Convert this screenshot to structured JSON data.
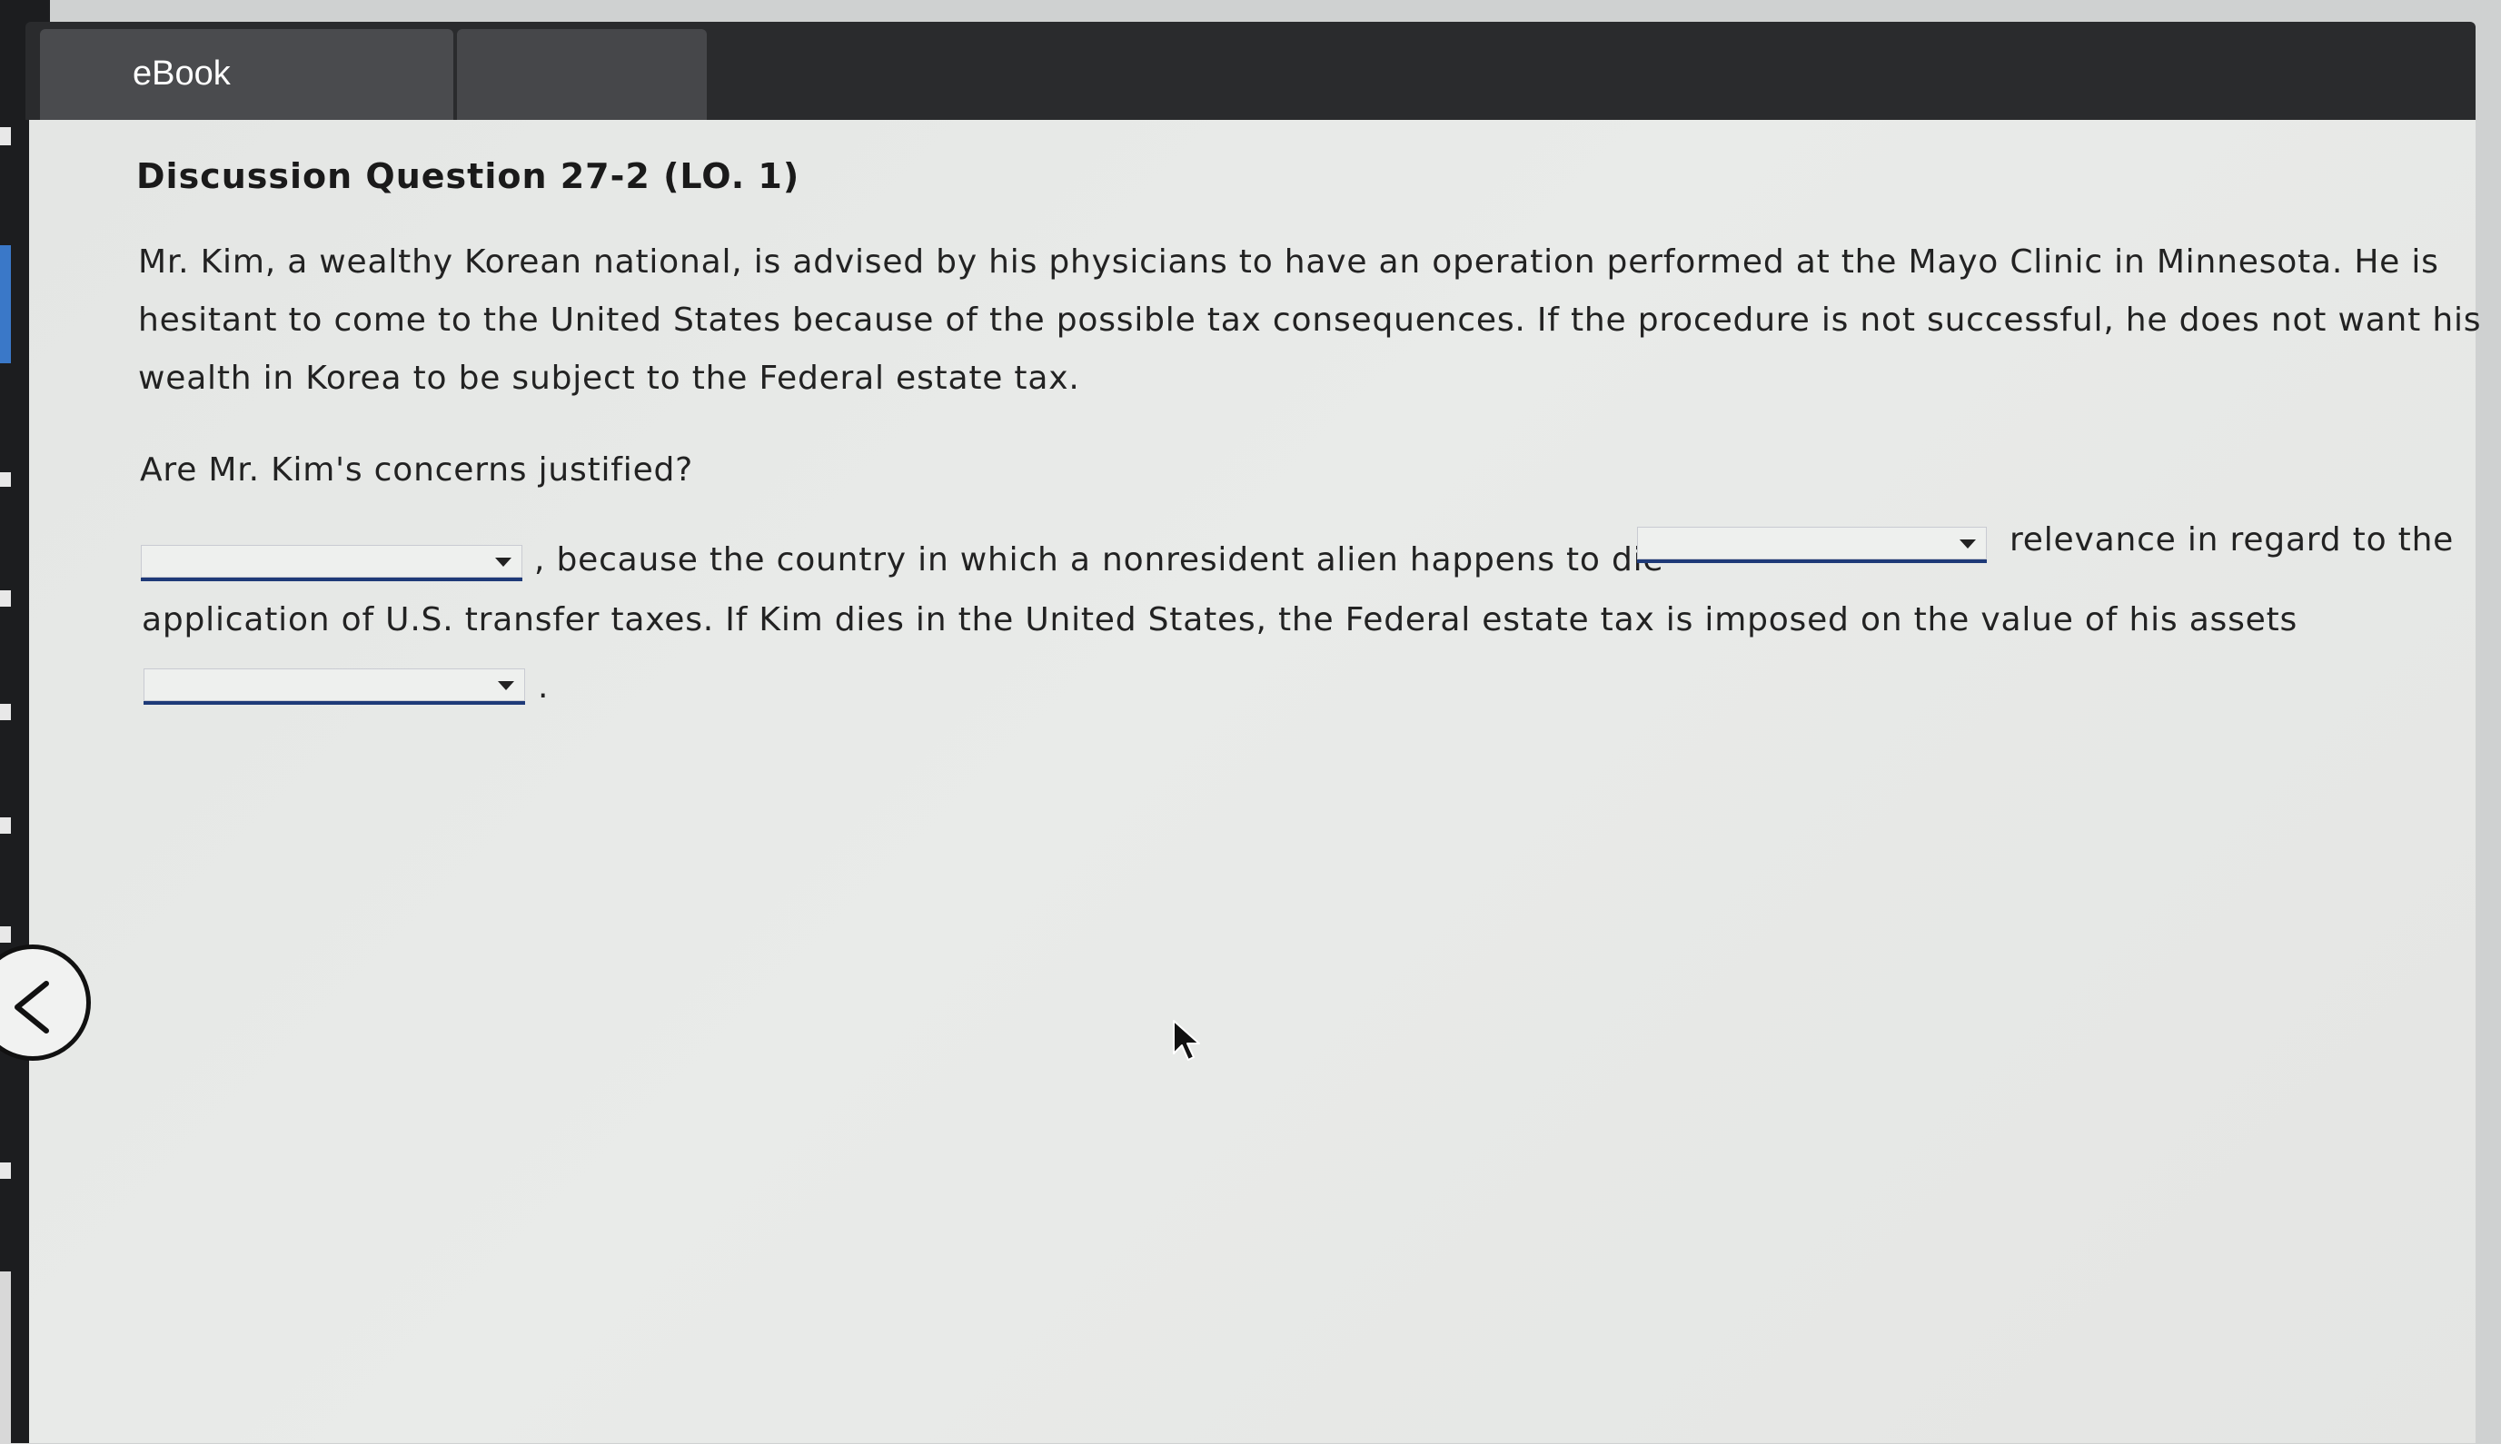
{
  "tabs": [
    {
      "label": "eBook"
    },
    {
      "label": ""
    }
  ],
  "question": {
    "title": "Discussion Question 27-2 (LO. 1)",
    "paragraph_lines": [
      "Mr. Kim, a wealthy Korean national, is advised by his physicians to have an operation performed at the Mayo Clinic in Minnesota. He is",
      "hesitant to come to the United States because of the possible tax consequences. If the procedure is not successful, he does not want his",
      "wealth in Korea to be subject to the Federal estate tax."
    ],
    "prompt": "Are Mr. Kim's concerns justified?"
  },
  "answer": {
    "segment1": ", because the country in which a nonresident alien happens to die",
    "segment2": "relevance in regard to the",
    "segment3": "application of U.S. transfer taxes. If Kim dies in the United States, the Federal estate tax is imposed on the value of his assets",
    "segment4": ".",
    "dropdown1_value": "",
    "dropdown2_value": "",
    "dropdown3_value": ""
  },
  "icons": {
    "back": "chevron-left-icon",
    "cursor": "mouse-pointer-icon",
    "dropdown_caret": "caret-down-icon"
  },
  "colors": {
    "top_bar": "#2a2b2d",
    "dropdown_underline": "#1e3a78",
    "content_bg": "#e6e8e6"
  }
}
